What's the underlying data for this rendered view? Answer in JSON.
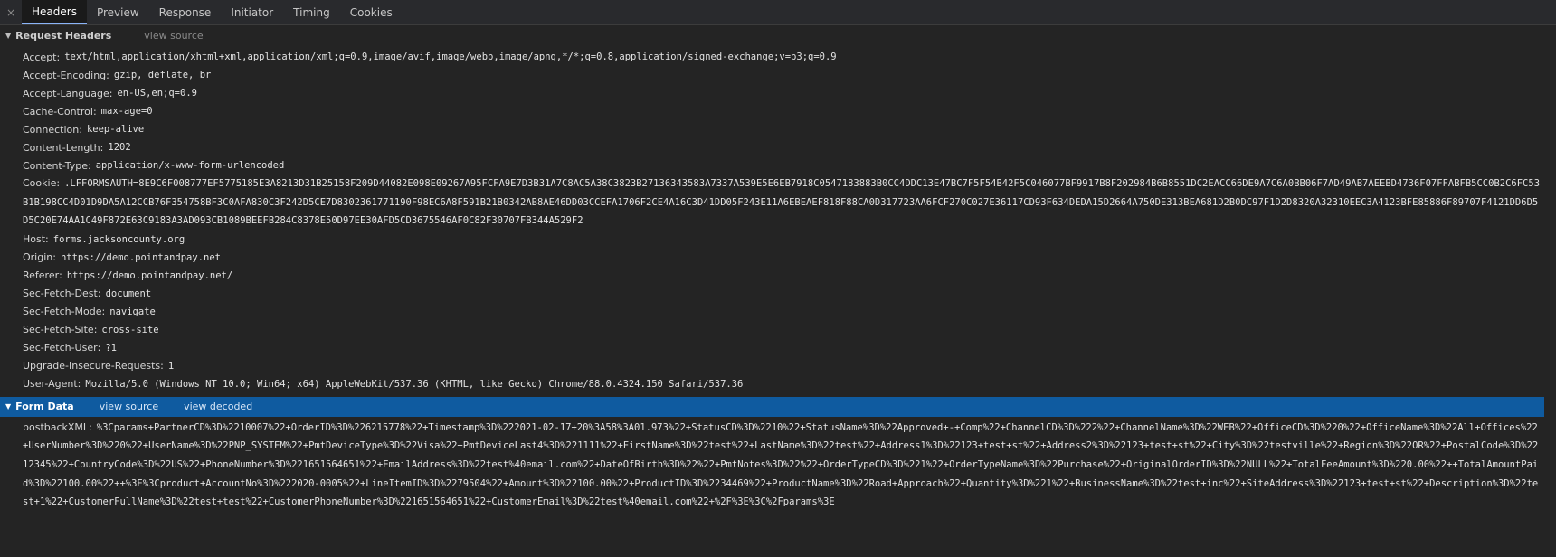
{
  "tabs": [
    "Headers",
    "Preview",
    "Response",
    "Initiator",
    "Timing",
    "Cookies"
  ],
  "close_glyph": "×",
  "request_headers": {
    "title": "Request Headers",
    "view_source": "view source",
    "items": [
      {
        "name": "Accept",
        "value": "text/html,application/xhtml+xml,application/xml;q=0.9,image/avif,image/webp,image/apng,*/*;q=0.8,application/signed-exchange;v=b3;q=0.9"
      },
      {
        "name": "Accept-Encoding",
        "value": "gzip, deflate, br"
      },
      {
        "name": "Accept-Language",
        "value": "en-US,en;q=0.9"
      },
      {
        "name": "Cache-Control",
        "value": "max-age=0"
      },
      {
        "name": "Connection",
        "value": "keep-alive"
      },
      {
        "name": "Content-Length",
        "value": "1202"
      },
      {
        "name": "Content-Type",
        "value": "application/x-www-form-urlencoded"
      },
      {
        "name": "Cookie",
        "value": ".LFFORMSAUTH=8E9C6F008777EF5775185E3A8213D31B25158F209D44082E098E09267A95FCFA9E7D3B31A7C8AC5A38C3823B27136343583A7337A539E5E6EB7918C0547183883B0CC4DDC13E47BC7F5F54B42F5C046077BF9917B8F202984B6B8551DC2EACC66DE9A7C6A0BB06F7AD49AB7AEEBD4736F07FFABFB5CC0B2C6FC53B1B198CC4D01D9DA5A12CCB76F354758BF3C0AFA830C3F242D5CE7D8302361771190F98EC6A8F591B21B0342AB8AE46DD03CCEFA1706F2CE4A16C3D41DD05F243E11A6EBEAEF818F88CA0D317723AA6FCF270C027E36117CD93F634DEDA15D2664A750DE313BEA681D2B0DC97F1D2D8320A32310EEC3A4123BFE85886F89707F4121DD6D5D5C20E74AA1C49F872E63C9183A3AD093CB1089BEEFB284C8378E50D97EE30AFD5CD3675546AF0C82F30707FB344A529F2"
      },
      {
        "name": "Host",
        "value": "forms.jacksoncounty.org"
      },
      {
        "name": "Origin",
        "value": "https://demo.pointandpay.net"
      },
      {
        "name": "Referer",
        "value": "https://demo.pointandpay.net/"
      },
      {
        "name": "Sec-Fetch-Dest",
        "value": "document"
      },
      {
        "name": "Sec-Fetch-Mode",
        "value": "navigate"
      },
      {
        "name": "Sec-Fetch-Site",
        "value": "cross-site"
      },
      {
        "name": "Sec-Fetch-User",
        "value": "?1"
      },
      {
        "name": "Upgrade-Insecure-Requests",
        "value": "1"
      },
      {
        "name": "User-Agent",
        "value": "Mozilla/5.0 (Windows NT 10.0; Win64; x64) AppleWebKit/537.36 (KHTML, like Gecko) Chrome/88.0.4324.150 Safari/537.36"
      }
    ]
  },
  "form_data": {
    "title": "Form Data",
    "view_source": "view source",
    "view_decoded": "view decoded",
    "items": [
      {
        "name": "postbackXML",
        "value": "%3Cparams+PartnerCD%3D%2210007%22+OrderID%3D%226215778%22+Timestamp%3D%222021-02-17+20%3A58%3A01.973%22+StatusCD%3D%2210%22+StatusName%3D%22Approved+-+Comp%22+ChannelCD%3D%222%22+ChannelName%3D%22WEB%22+OfficeCD%3D%220%22+OfficeName%3D%22All+Offices%22+UserNumber%3D%220%22+UserName%3D%22PNP_SYSTEM%22+PmtDeviceType%3D%22Visa%22+PmtDeviceLast4%3D%221111%22+FirstName%3D%22test%22+LastName%3D%22test%22+Address1%3D%22123+test+st%22+Address2%3D%22123+test+st%22+City%3D%22testville%22+Region%3D%22OR%22+PostalCode%3D%2212345%22+CountryCode%3D%22US%22+PhoneNumber%3D%221651564651%22+EmailAddress%3D%22test%40email.com%22+DateOfBirth%3D%22%22+PmtNotes%3D%22%22+OrderTypeCD%3D%221%22+OrderTypeName%3D%22Purchase%22+OriginalOrderID%3D%22NULL%22+TotalFeeAmount%3D%220.00%22++TotalAmountPaid%3D%22100.00%22++%3E%3Cproduct+AccountNo%3D%222020-0005%22+LineItemID%3D%2279504%22+Amount%3D%22100.00%22+ProductID%3D%2234469%22+ProductName%3D%22Road+Approach%22+Quantity%3D%221%22+BusinessName%3D%22test+inc%22+SiteAddress%3D%22123+test+st%22+Description%3D%22test+1%22+CustomerFullName%3D%22test+test%22+CustomerPhoneNumber%3D%221651564651%22+CustomerEmail%3D%22test%40email.com%22+%2F%3E%3C%2Fparams%3E"
      }
    ]
  }
}
